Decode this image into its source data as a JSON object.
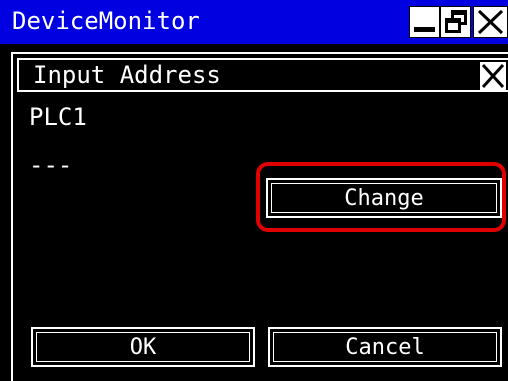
{
  "window": {
    "title": "DeviceMonitor",
    "icons": [
      "minimize-icon",
      "maximize-icon",
      "close-icon"
    ]
  },
  "dialog": {
    "title": "Input Address",
    "device": "PLC1",
    "address_value": "---",
    "change_label": "Change",
    "ok_label": "OK",
    "cancel_label": "Cancel"
  },
  "colors": {
    "titlebar": "#0000e0",
    "background": "#000000",
    "text": "#ffffff",
    "highlight": "#e00000"
  }
}
